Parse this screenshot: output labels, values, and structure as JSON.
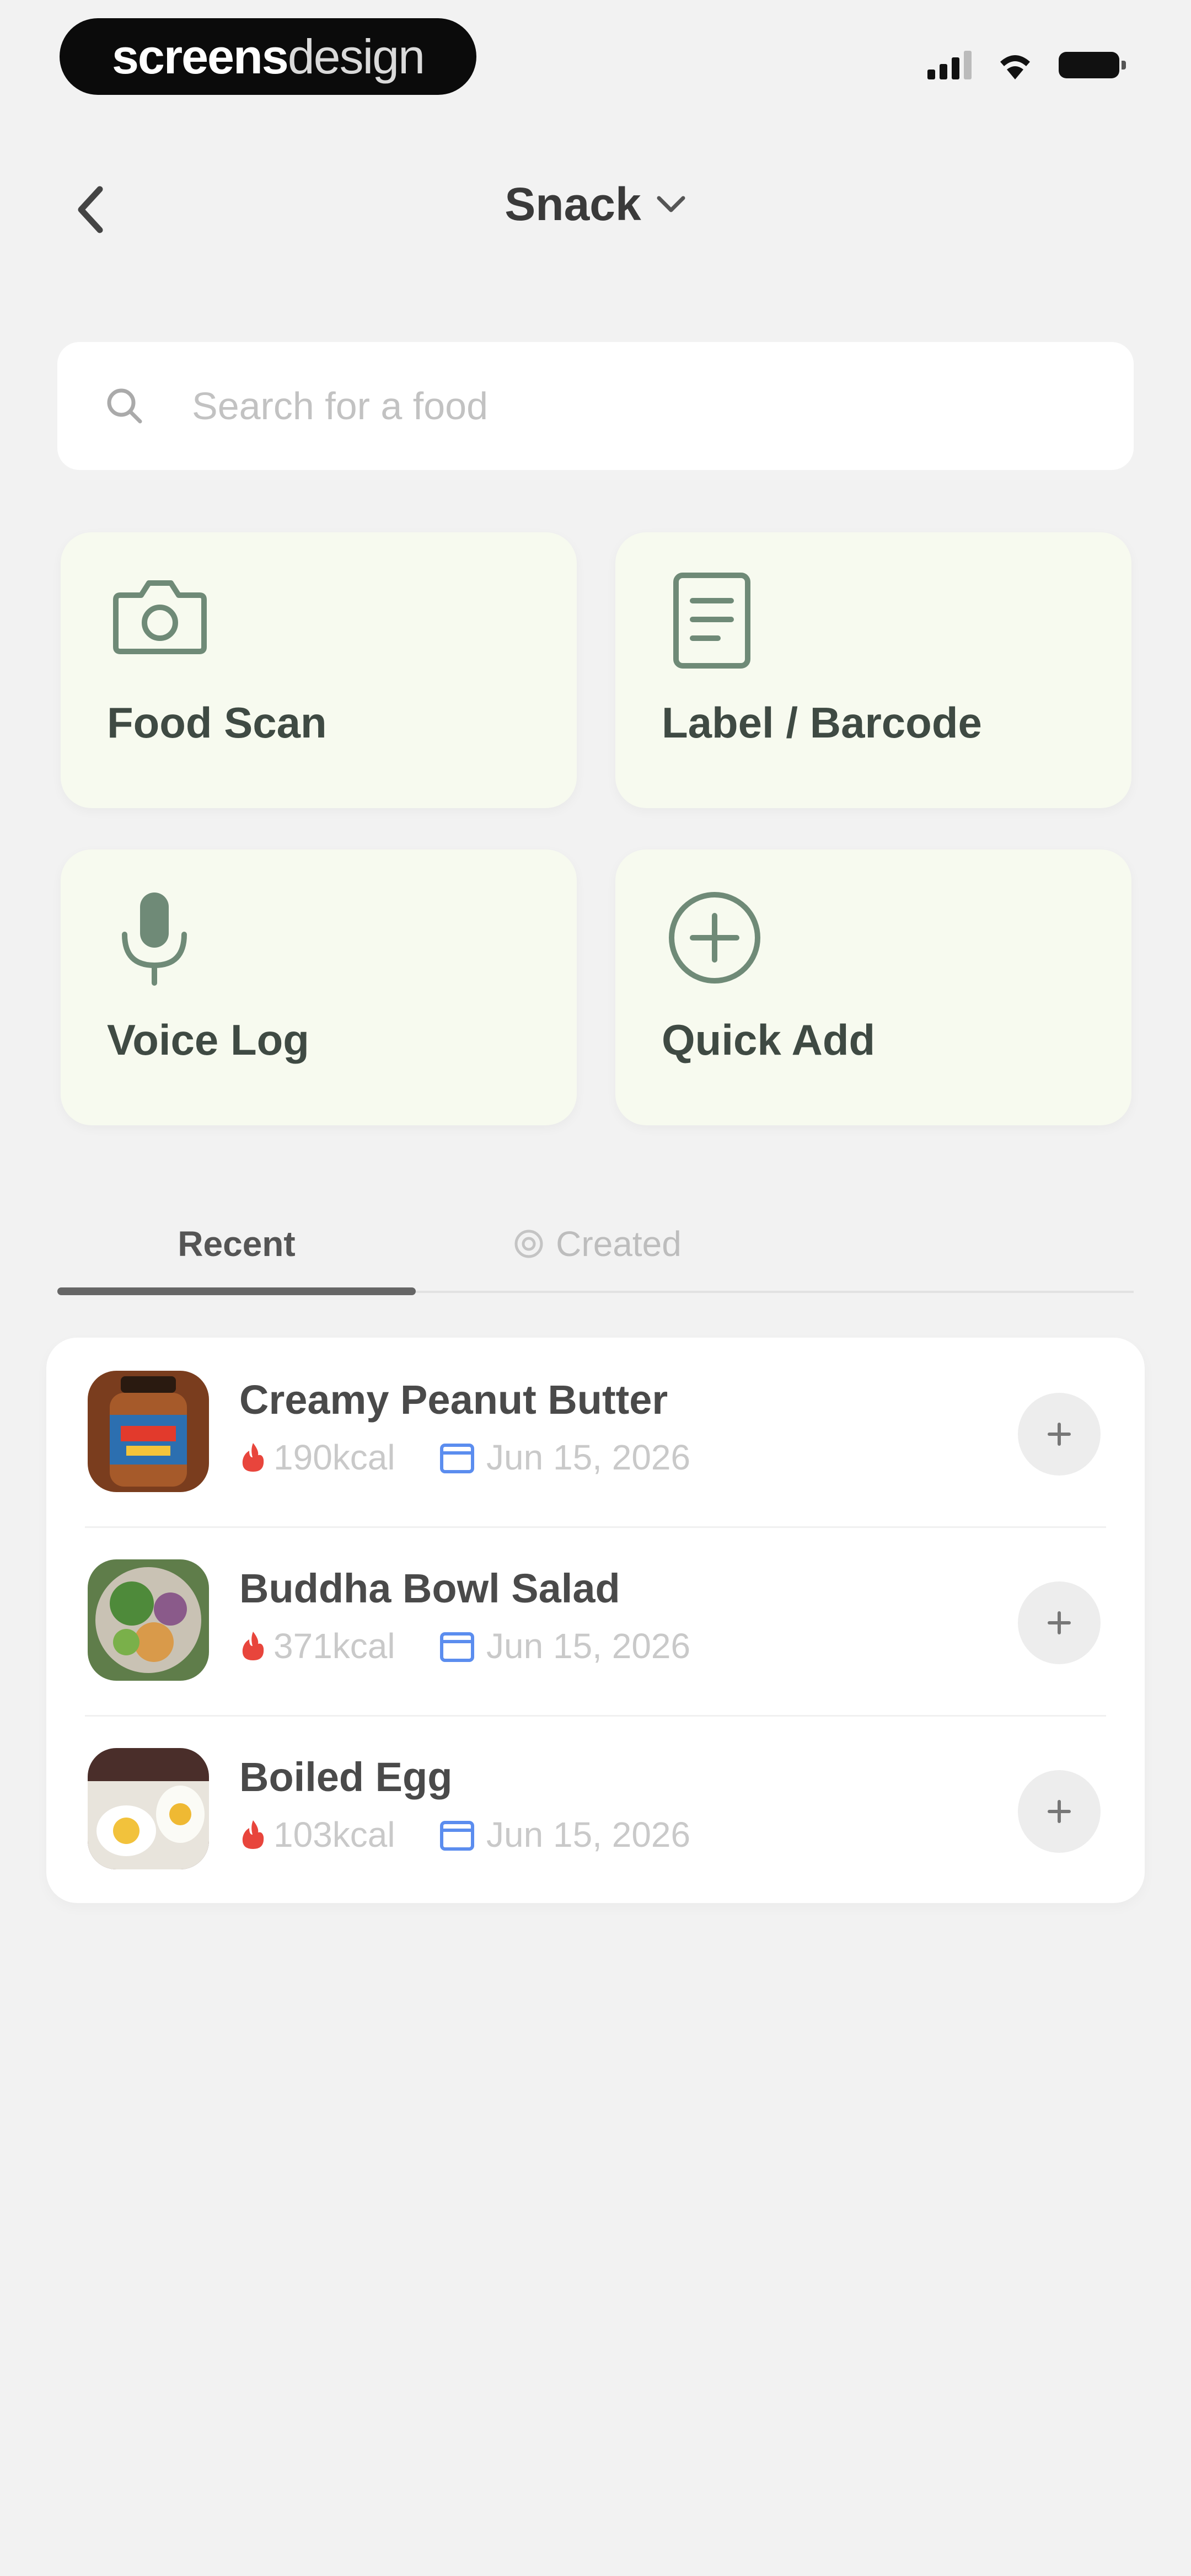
{
  "status_bar": {
    "brand_bold": "screens",
    "brand_light": "design"
  },
  "header": {
    "title": "Snack"
  },
  "search": {
    "placeholder": "Search for a food"
  },
  "actions": [
    {
      "label": "Food Scan",
      "icon": "camera-icon"
    },
    {
      "label": "Label / Barcode",
      "icon": "document-icon"
    },
    {
      "label": "Voice Log",
      "icon": "microphone-icon"
    },
    {
      "label": "Quick Add",
      "icon": "plus-circle-icon"
    }
  ],
  "tabs": {
    "recent": "Recent",
    "created": "Created",
    "active": "recent"
  },
  "recent_items": [
    {
      "name": "Creamy Peanut Butter",
      "kcal": "190kcal",
      "date": "Jun 15, 2026"
    },
    {
      "name": "Buddha Bowl Salad",
      "kcal": "371kcal",
      "date": "Jun 15, 2026"
    },
    {
      "name": "Boiled Egg",
      "kcal": "103kcal",
      "date": "Jun 15, 2026"
    }
  ],
  "colors": {
    "background": "#f2f2f2",
    "card_bg": "#f7faef",
    "icon_green": "#6f8a77",
    "flame_red": "#e8453c",
    "calendar_blue": "#5b8def"
  }
}
